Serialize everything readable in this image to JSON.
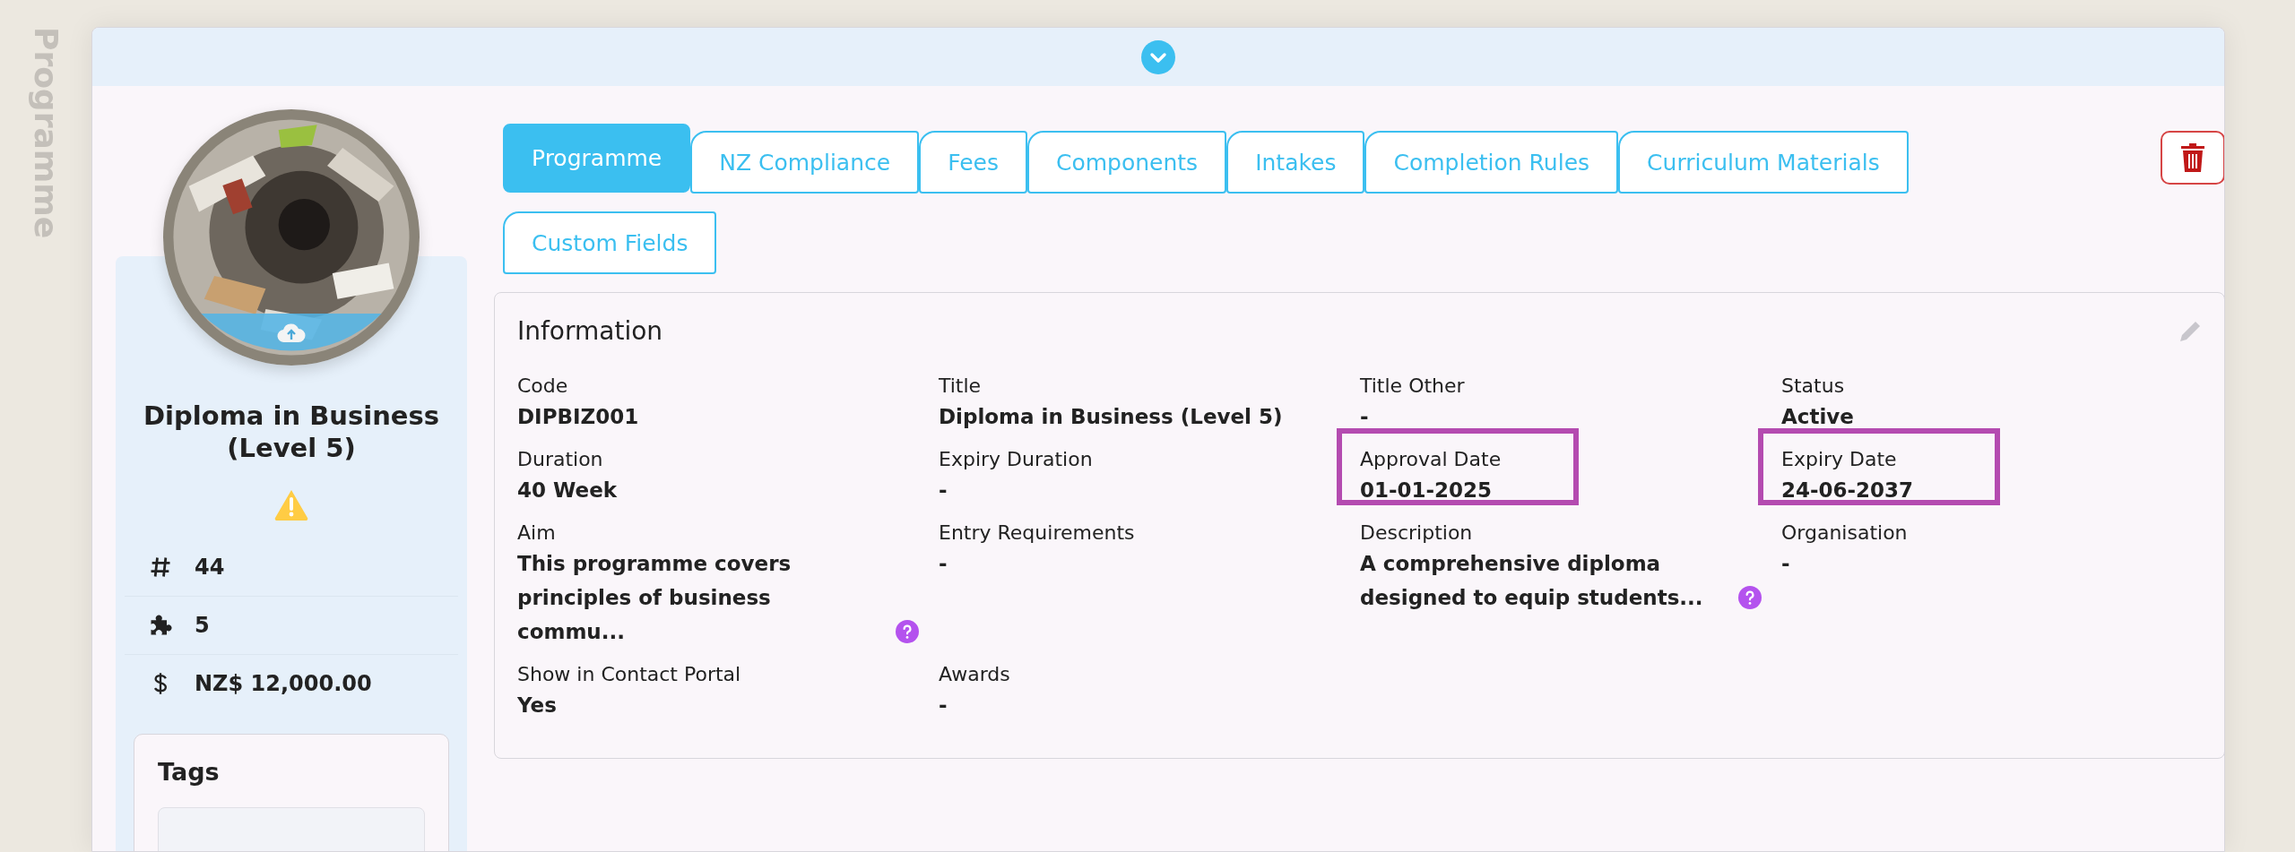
{
  "side_label": "Programme",
  "programme": {
    "title": "Diploma in Business (Level 5)",
    "warning": true,
    "stats": [
      {
        "kind": "hash",
        "value": "44"
      },
      {
        "kind": "puzzle",
        "value": "5"
      },
      {
        "kind": "dollar",
        "value": "NZ$ 12,000.00"
      }
    ]
  },
  "tags": {
    "title": "Tags"
  },
  "tabs": [
    {
      "label": "Programme",
      "selected": true
    },
    {
      "label": "NZ Compliance",
      "selected": false
    },
    {
      "label": "Fees",
      "selected": false
    },
    {
      "label": "Components",
      "selected": false
    },
    {
      "label": "Intakes",
      "selected": false
    },
    {
      "label": "Completion Rules",
      "selected": false
    },
    {
      "label": "Curriculum Materials",
      "selected": false
    },
    {
      "label": "Custom Fields",
      "selected": false
    }
  ],
  "information": {
    "title": "Information",
    "fields": [
      {
        "label": "Code",
        "value": "DIPBIZ001",
        "help": false,
        "highlighted": false
      },
      {
        "label": "Title",
        "value": "Diploma in Business (Level 5)",
        "help": false,
        "highlighted": false
      },
      {
        "label": "Title Other",
        "value": "-",
        "help": false,
        "highlighted": false
      },
      {
        "label": "Status",
        "value": "Active",
        "help": false,
        "highlighted": false
      },
      {
        "label": "Duration",
        "value": "40 Week",
        "help": false,
        "highlighted": false
      },
      {
        "label": "Expiry Duration",
        "value": "-",
        "help": false,
        "highlighted": false
      },
      {
        "label": "Approval Date",
        "value": "01-01-2025",
        "help": false,
        "highlighted": true
      },
      {
        "label": "Expiry Date",
        "value": "24-06-2037",
        "help": false,
        "highlighted": true
      },
      {
        "label": "Aim",
        "value": "This programme covers principles of business commu...",
        "help": true,
        "highlighted": false
      },
      {
        "label": "Entry Requirements",
        "value": "-",
        "help": false,
        "highlighted": false
      },
      {
        "label": "Description",
        "value": "A comprehensive diploma designed to equip students...",
        "help": true,
        "highlighted": false
      },
      {
        "label": "Organisation",
        "value": "-",
        "help": false,
        "highlighted": false
      },
      {
        "label": "Show in Contact Portal",
        "value": "Yes",
        "help": false,
        "highlighted": false
      },
      {
        "label": "Awards",
        "value": "-",
        "help": false,
        "highlighted": false
      }
    ]
  }
}
